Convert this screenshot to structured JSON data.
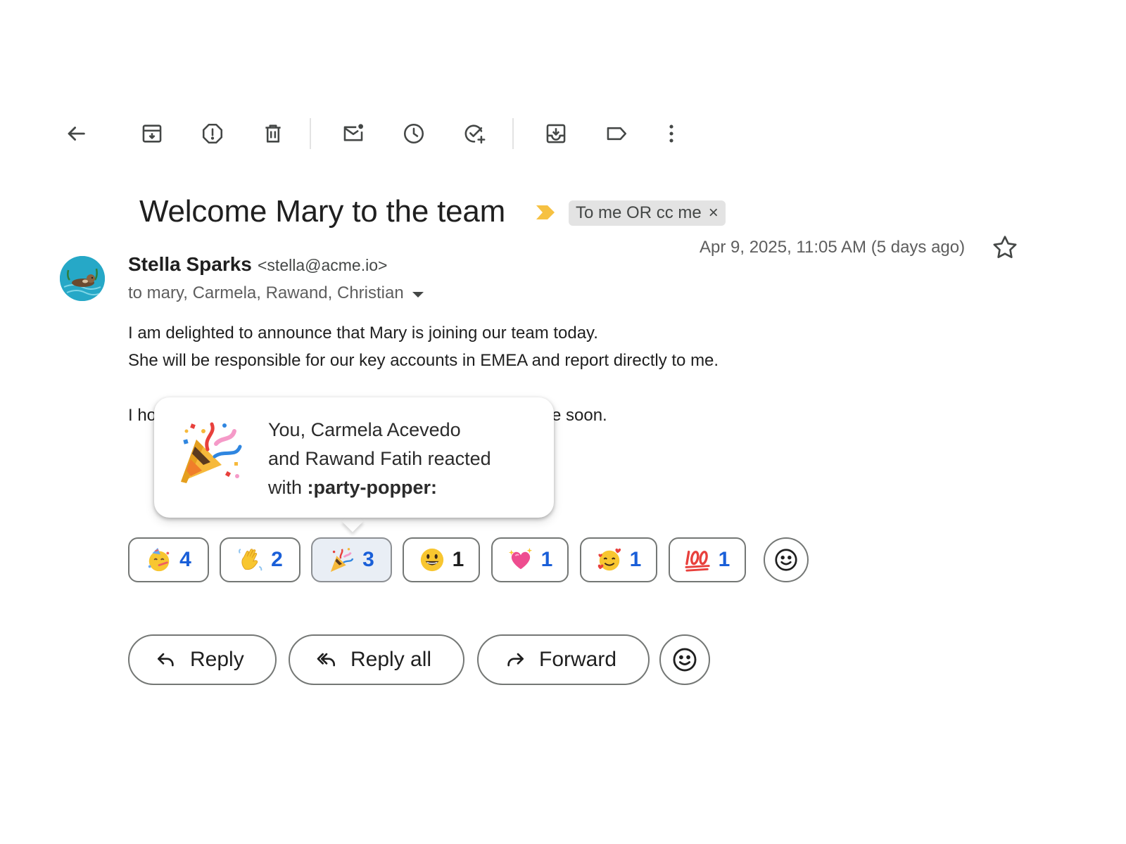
{
  "toolbar": {
    "buttons": [
      {
        "name": "back-button",
        "icon": "arrow-left-icon"
      },
      {
        "name": "archive-button",
        "icon": "archive-icon"
      },
      {
        "name": "report-spam-button",
        "icon": "report-spam-icon"
      },
      {
        "name": "delete-button",
        "icon": "trash-icon"
      },
      {
        "name": "mark-unread-button",
        "icon": "mark-unread-icon"
      },
      {
        "name": "snooze-button",
        "icon": "clock-icon"
      },
      {
        "name": "add-to-tasks-button",
        "icon": "add-task-icon"
      },
      {
        "name": "move-to-button",
        "icon": "move-to-inbox-icon"
      },
      {
        "name": "labels-button",
        "icon": "label-icon"
      },
      {
        "name": "more-button",
        "icon": "more-vertical-icon"
      }
    ]
  },
  "message": {
    "subject": "Welcome Mary to the team",
    "label": "To me OR cc me",
    "label_close": "×",
    "date": "Apr 9, 2025, 11:05 AM (5 days ago)",
    "sender_name": "Stella Sparks",
    "sender_email": "<stella@acme.io>",
    "recipients": "to mary, Carmela, Rawand, Christian",
    "body": {
      "line1": "I am delighted to announce that Mary is joining our team today.",
      "line2": "She will be responsible for our key accounts in EMEA and report directly to me.",
      "line3_start": "I ho",
      "line3_end": "e soon."
    }
  },
  "tooltip": {
    "line1": "You, Carmela Acevedo",
    "line2": "and Rawand Fatih reacted",
    "line3_prefix": "with ",
    "emoji_code": ":party-popper:"
  },
  "reactions": [
    {
      "emoji": "partying-face",
      "count": "4"
    },
    {
      "emoji": "waving-hand",
      "count": "2"
    },
    {
      "emoji": "party-popper",
      "count": "3",
      "selected": true
    },
    {
      "emoji": "grinning-face",
      "count": "1"
    },
    {
      "emoji": "sparkling-heart",
      "count": "1"
    },
    {
      "emoji": "smiling-face-with-hearts",
      "count": "1"
    },
    {
      "emoji": "hundred-points",
      "count": "1"
    }
  ],
  "actions": {
    "reply": "Reply",
    "reply_all": "Reply all",
    "forward": "Forward"
  },
  "colors": {
    "accent_count": "#1a5fd8",
    "importance_marker": "#f6c142",
    "avatar_bg": "#26a8c7",
    "chip_bg": "#e3e3e3"
  }
}
